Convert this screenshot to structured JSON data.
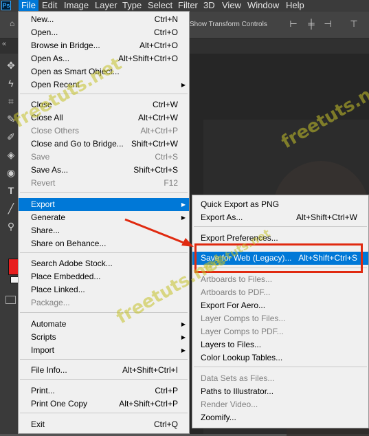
{
  "menubar": {
    "app_icon": "Ps",
    "items": [
      "File",
      "Edit",
      "Image",
      "Layer",
      "Type",
      "Select",
      "Filter",
      "3D",
      "View",
      "Window",
      "Help"
    ]
  },
  "options_bar": {
    "show_transform_controls": "Show Transform Controls"
  },
  "tab_bar": {
    "collapse": "«"
  },
  "toolbar": {
    "tools": [
      "move-icon",
      "lasso-icon",
      "crop-icon",
      "eyedropper-icon",
      "brush-icon",
      "paint-bucket-icon",
      "eye-icon",
      "type-icon",
      "line-icon",
      "zoom-icon"
    ],
    "foreground_color": "#e81f1f",
    "background_color": "#f2f2f2"
  },
  "file_menu": [
    {
      "label": "New...",
      "shortcut": "Ctrl+N",
      "disabled": false,
      "submenu": false
    },
    {
      "label": "Open...",
      "shortcut": "Ctrl+O",
      "disabled": false,
      "submenu": false
    },
    {
      "label": "Browse in Bridge...",
      "shortcut": "Alt+Ctrl+O",
      "disabled": false,
      "submenu": false
    },
    {
      "label": "Open As...",
      "shortcut": "Alt+Shift+Ctrl+O",
      "disabled": false,
      "submenu": false
    },
    {
      "label": "Open as Smart Object...",
      "shortcut": "",
      "disabled": false,
      "submenu": false
    },
    {
      "label": "Open Recent",
      "shortcut": "",
      "disabled": false,
      "submenu": true
    },
    {
      "label": "Close",
      "shortcut": "Ctrl+W",
      "disabled": false,
      "submenu": false
    },
    {
      "label": "Close All",
      "shortcut": "Alt+Ctrl+W",
      "disabled": false,
      "submenu": false
    },
    {
      "label": "Close Others",
      "shortcut": "Alt+Ctrl+P",
      "disabled": true,
      "submenu": false
    },
    {
      "label": "Close and Go to Bridge...",
      "shortcut": "Shift+Ctrl+W",
      "disabled": false,
      "submenu": false
    },
    {
      "label": "Save",
      "shortcut": "Ctrl+S",
      "disabled": true,
      "submenu": false
    },
    {
      "label": "Save As...",
      "shortcut": "Shift+Ctrl+S",
      "disabled": false,
      "submenu": false
    },
    {
      "label": "Revert",
      "shortcut": "F12",
      "disabled": true,
      "submenu": false
    },
    {
      "label": "Export",
      "shortcut": "",
      "disabled": false,
      "submenu": true,
      "highlighted": true
    },
    {
      "label": "Generate",
      "shortcut": "",
      "disabled": false,
      "submenu": true
    },
    {
      "label": "Share...",
      "shortcut": "",
      "disabled": false,
      "submenu": false
    },
    {
      "label": "Share on Behance...",
      "shortcut": "",
      "disabled": false,
      "submenu": false
    },
    {
      "label": "Search Adobe Stock...",
      "shortcut": "",
      "disabled": false,
      "submenu": false
    },
    {
      "label": "Place Embedded...",
      "shortcut": "",
      "disabled": false,
      "submenu": false
    },
    {
      "label": "Place Linked...",
      "shortcut": "",
      "disabled": false,
      "submenu": false
    },
    {
      "label": "Package...",
      "shortcut": "",
      "disabled": true,
      "submenu": false
    },
    {
      "label": "Automate",
      "shortcut": "",
      "disabled": false,
      "submenu": true
    },
    {
      "label": "Scripts",
      "shortcut": "",
      "disabled": false,
      "submenu": true
    },
    {
      "label": "Import",
      "shortcut": "",
      "disabled": false,
      "submenu": true
    },
    {
      "label": "File Info...",
      "shortcut": "Alt+Shift+Ctrl+I",
      "disabled": false,
      "submenu": false
    },
    {
      "label": "Print...",
      "shortcut": "Ctrl+P",
      "disabled": false,
      "submenu": false
    },
    {
      "label": "Print One Copy",
      "shortcut": "Alt+Shift+Ctrl+P",
      "disabled": false,
      "submenu": false
    },
    {
      "label": "Exit",
      "shortcut": "Ctrl+Q",
      "disabled": false,
      "submenu": false
    }
  ],
  "export_menu": [
    {
      "label": "Quick Export as PNG",
      "shortcut": "",
      "disabled": false
    },
    {
      "label": "Export As...",
      "shortcut": "Alt+Shift+Ctrl+W",
      "disabled": false
    },
    {
      "label": "Export Preferences...",
      "shortcut": "",
      "disabled": false
    },
    {
      "label": "Save for Web (Legacy)...",
      "shortcut": "Alt+Shift+Ctrl+S",
      "disabled": false,
      "highlighted": true
    },
    {
      "label": "Artboards to Files...",
      "shortcut": "",
      "disabled": true
    },
    {
      "label": "Artboards to PDF...",
      "shortcut": "",
      "disabled": true
    },
    {
      "label": "Export For Aero...",
      "shortcut": "",
      "disabled": false
    },
    {
      "label": "Layer Comps to Files...",
      "shortcut": "",
      "disabled": true
    },
    {
      "label": "Layer Comps to PDF...",
      "shortcut": "",
      "disabled": true
    },
    {
      "label": "Layers to Files...",
      "shortcut": "",
      "disabled": false
    },
    {
      "label": "Color Lookup Tables...",
      "shortcut": "",
      "disabled": false
    },
    {
      "label": "Data Sets as Files...",
      "shortcut": "",
      "disabled": true
    },
    {
      "label": "Paths to Illustrator...",
      "shortcut": "",
      "disabled": false
    },
    {
      "label": "Render Video...",
      "shortcut": "",
      "disabled": true
    },
    {
      "label": "Zoomify...",
      "shortcut": "",
      "disabled": false
    }
  ],
  "watermark": "freetuts.net",
  "colors": {
    "highlight": "#0078d7",
    "annotation": "#e02a10",
    "menu_bg": "#f0f0f0"
  }
}
